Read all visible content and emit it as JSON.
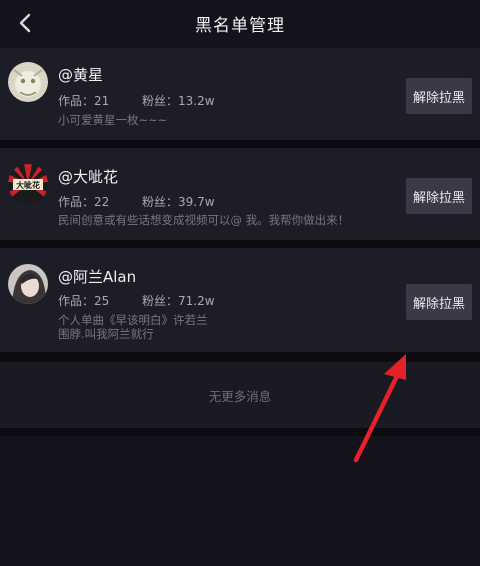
{
  "header": {
    "title": "黑名单管理"
  },
  "users": [
    {
      "name": "@黄星",
      "works": "作品：21",
      "fans": "粉丝：13.2w",
      "bio": [
        "小可爱黄星一枚~~~"
      ],
      "action": "解除拉黑"
    },
    {
      "name": "@大呲花",
      "works": "作品：22",
      "fans": "粉丝：39.7w",
      "bio": [
        "民间创意或有些话想变成视频可以@ 我。我帮你做出来！"
      ],
      "action": "解除拉黑"
    },
    {
      "name": "@阿兰Alan",
      "works": "作品：25",
      "fans": "粉丝：71.2w",
      "bio": [
        "个人单曲《早该明白》许若兰",
        "围脖.叫我阿兰就行"
      ],
      "action": "解除拉黑"
    }
  ],
  "footer": {
    "no_more": "无更多消息"
  },
  "colors": {
    "background": "#14131c",
    "card": "#1d1d27",
    "button": "#3a3a46",
    "annotation_arrow": "#e8202a"
  },
  "avatar_2_logo_text": "大呲花"
}
